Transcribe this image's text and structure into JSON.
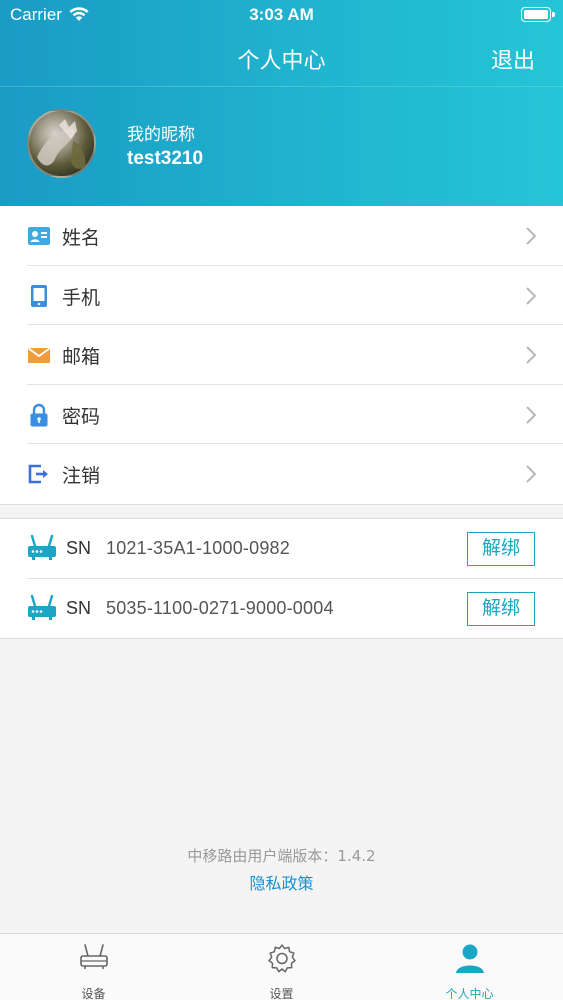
{
  "status_bar": {
    "carrier": "Carrier",
    "time": "3:03 AM"
  },
  "nav": {
    "title": "个人中心",
    "logout": "退出"
  },
  "profile": {
    "nickname_label": "我的昵称",
    "nickname_value": "test3210"
  },
  "menu": [
    {
      "label": "姓名",
      "icon": "id-card-icon",
      "color": "#3fa9e0"
    },
    {
      "label": "手机",
      "icon": "phone-icon",
      "color": "#3a8ee0"
    },
    {
      "label": "邮箱",
      "icon": "mail-icon",
      "color": "#f29a3e"
    },
    {
      "label": "密码",
      "icon": "lock-icon",
      "color": "#3a8ee0"
    },
    {
      "label": "注销",
      "icon": "logout-icon",
      "color": "#3a6fd8"
    }
  ],
  "devices": {
    "sn_label": "SN",
    "unbind_label": "解绑",
    "items": [
      {
        "sn": "1021-35A1-1000-0982"
      },
      {
        "sn": "5035-1100-0271-9000-0004"
      }
    ]
  },
  "footer": {
    "version": "中移路由用户端版本：1.4.2",
    "privacy": "隐私政策"
  },
  "tabbar": {
    "active_index": 2,
    "tabs": [
      {
        "label": "设备",
        "icon": "router-icon"
      },
      {
        "label": "设置",
        "icon": "gear-icon"
      },
      {
        "label": "个人中心",
        "icon": "person-icon"
      }
    ]
  },
  "colors": {
    "accent": "#1aa6c4",
    "header_start": "#1a9bc5",
    "header_end": "#24c5d6",
    "link": "#1a8fd6"
  }
}
